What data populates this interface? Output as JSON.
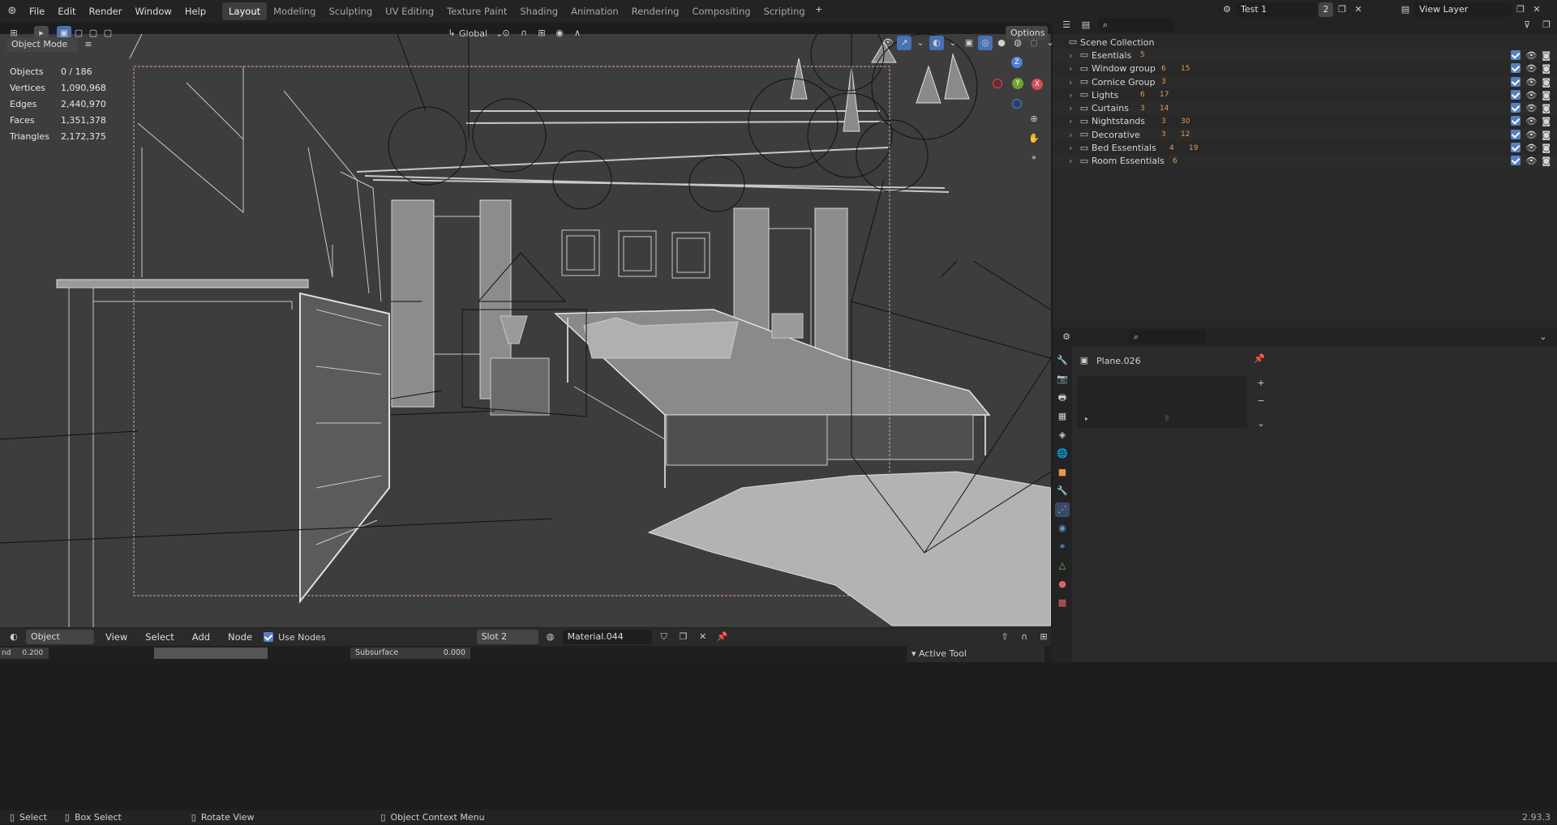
{
  "menus": [
    "File",
    "Edit",
    "Render",
    "Window",
    "Help"
  ],
  "workspaces": [
    "Layout",
    "Modeling",
    "Sculpting",
    "UV Editing",
    "Texture Paint",
    "Shading",
    "Animation",
    "Rendering",
    "Compositing",
    "Scripting"
  ],
  "active_workspace": "Layout",
  "scene": {
    "name": "Test 1",
    "users": "2",
    "view_layer": "View Layer"
  },
  "viewport": {
    "mode": "Object Mode",
    "orientation": "Global",
    "options_label": "Options",
    "stats": [
      {
        "label": "Objects",
        "value": "0 / 186"
      },
      {
        "label": "Vertices",
        "value": "1,090,968"
      },
      {
        "label": "Edges",
        "value": "2,440,970"
      },
      {
        "label": "Faces",
        "value": "1,351,378"
      },
      {
        "label": "Triangles",
        "value": "2,172,375"
      }
    ],
    "gizmo": {
      "z": "Z",
      "y": "Y",
      "x": "X"
    }
  },
  "outliner": {
    "root": "Scene Collection",
    "items": [
      {
        "name": "Esentials",
        "badges": [
          "5"
        ]
      },
      {
        "name": "Window group",
        "badges": [
          "6",
          "15"
        ]
      },
      {
        "name": "Cornice Group",
        "badges": [
          "3"
        ]
      },
      {
        "name": "Lights",
        "badges": [
          "6",
          "17"
        ]
      },
      {
        "name": "Curtains",
        "badges": [
          "3",
          "14"
        ]
      },
      {
        "name": "Nightstands",
        "badges": [
          "3",
          "30"
        ]
      },
      {
        "name": "Decorative",
        "badges": [
          "3",
          "12"
        ]
      },
      {
        "name": "Bed Essentials",
        "badges": [
          "4",
          "19"
        ]
      },
      {
        "name": "Room Essentials",
        "badges": [
          "6"
        ]
      }
    ]
  },
  "properties": {
    "object": "Plane.026"
  },
  "node_editor": {
    "type": "Object",
    "menus": [
      "View",
      "Select",
      "Add",
      "Node"
    ],
    "use_nodes": "Use Nodes",
    "slot": "Slot 2",
    "material": "Material.044",
    "field_left": "nd",
    "field_left_value": "0.200",
    "subsurface_label": "Subsurface",
    "subsurface_value": "0.000",
    "active_tool": "Active Tool"
  },
  "status": {
    "select": "Select",
    "box_select": "Box Select",
    "rotate": "Rotate View",
    "context_menu": "Object Context Menu",
    "version": "2.93.3"
  },
  "colors": {
    "accent": "#4772b3",
    "orange": "#e6994d",
    "viewport_bg": "#3d3d3d"
  }
}
